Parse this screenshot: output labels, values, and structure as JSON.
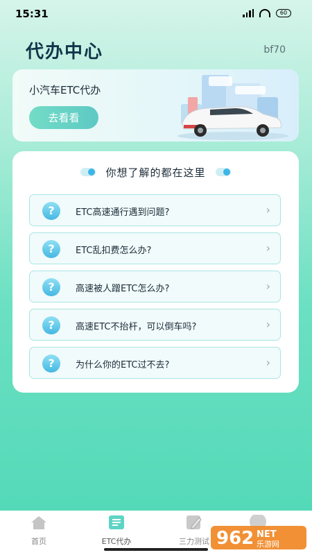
{
  "status": {
    "time": "15:31",
    "battery": "60"
  },
  "header": {
    "title": "代办中心",
    "version": "bf70"
  },
  "banner": {
    "title": "小汽车ETC代办",
    "button": "去看看"
  },
  "faq": {
    "heading": "你想了解的都在这里",
    "items": [
      {
        "icon": "?",
        "text": "ETC高速通行遇到问题?"
      },
      {
        "icon": "?",
        "text": "ETC乱扣费怎么办?"
      },
      {
        "icon": "?",
        "text": "高速被人蹭ETC怎么办?"
      },
      {
        "icon": "?",
        "text": "高速ETC不抬杆，可以倒车吗?"
      },
      {
        "icon": "?",
        "text": "为什么你的ETC过不去?"
      }
    ]
  },
  "nav": {
    "items": [
      {
        "label": "首页",
        "icon": "home-icon"
      },
      {
        "label": "ETC代办",
        "icon": "list-icon"
      },
      {
        "label": "三力测试",
        "icon": "edit-icon"
      }
    ]
  },
  "watermark": {
    "brand": "962",
    "net": "NET",
    "text": "乐游网"
  }
}
